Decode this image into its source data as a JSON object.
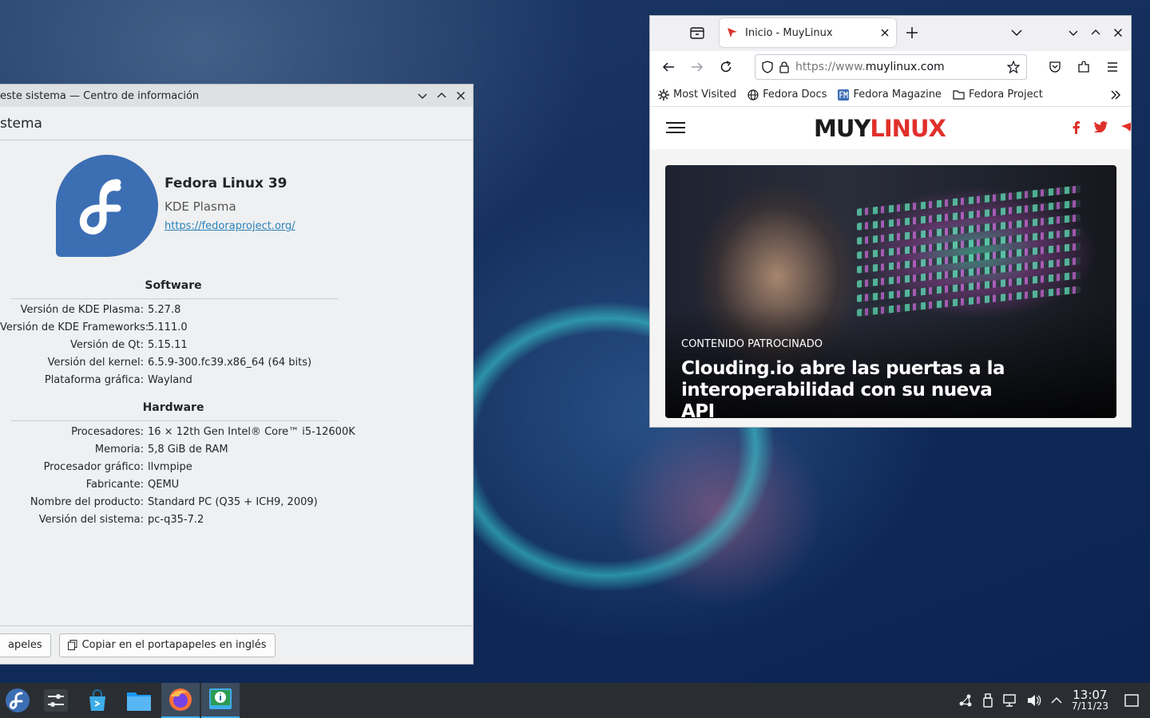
{
  "kinfo": {
    "title": "este sistema — Centro de información",
    "header": "stema",
    "distro_name": "Fedora Linux 39",
    "desktop": "KDE Plasma",
    "url": "https://fedoraproject.org/",
    "software_title": "Software",
    "software": [
      {
        "k": "Versión de KDE Plasma:",
        "v": "5.27.8"
      },
      {
        "k": "Versión de KDE Frameworks:",
        "v": "5.111.0"
      },
      {
        "k": "Versión de Qt:",
        "v": "5.15.11"
      },
      {
        "k": "Versión del kernel:",
        "v": "6.5.9-300.fc39.x86_64 (64 bits)"
      },
      {
        "k": "Plataforma gráfica:",
        "v": "Wayland"
      }
    ],
    "hardware_title": "Hardware",
    "hardware": [
      {
        "k": "Procesadores:",
        "v": "16 × 12th Gen Intel® Core™ i5-12600K"
      },
      {
        "k": "Memoria:",
        "v": "5,8 GiB de RAM"
      },
      {
        "k": "Procesador gráfico:",
        "v": "llvmpipe"
      },
      {
        "k": "Fabricante:",
        "v": "QEMU"
      },
      {
        "k": "Nombre del producto:",
        "v": "Standard PC (Q35 + ICH9, 2009)"
      },
      {
        "k": "Versión del sistema:",
        "v": "pc-q35-7.2"
      }
    ],
    "btn_copy": "apeles",
    "btn_copy_en": "Copiar en el portapapeles en inglés"
  },
  "firefox": {
    "tab_title": "Inicio - MuyLinux",
    "url_prefix": "https://www.",
    "url_domain": "muylinux.com",
    "bookmarks": [
      "Most Visited",
      "Fedora Docs",
      "Fedora Magazine",
      "Fedora Project"
    ],
    "brand_muy": "MUY",
    "brand_linux": "LINUX",
    "hero_tag": "CONTENIDO PATROCINADO",
    "hero_title": "Clouding.io abre las puertas a la interoperabilidad con su nueva API"
  },
  "taskbar": {
    "time": "13:07",
    "date": "7/11/23",
    "apps": [
      "fedora-launcher",
      "system-settings",
      "discover",
      "dolphin",
      "firefox",
      "info-center"
    ]
  },
  "colors": {
    "accent": "#3daee9",
    "fedora_blue": "#3c6eb4",
    "muylinux_red": "#e0302b"
  }
}
